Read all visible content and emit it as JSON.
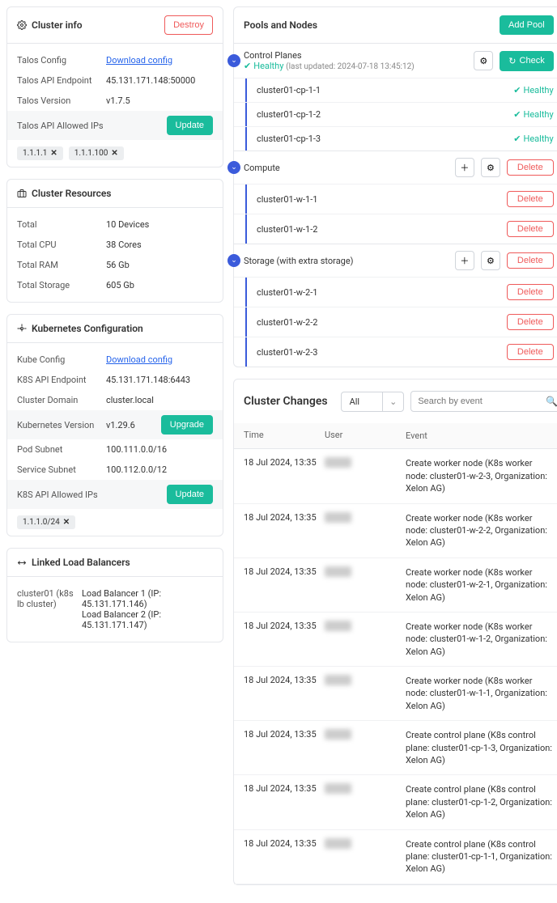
{
  "clusterInfo": {
    "title": "Cluster info",
    "destroy": "Destroy",
    "talosConfigLabel": "Talos Config",
    "talosConfigLink": "Download config",
    "talosApiLabel": "Talos API Endpoint",
    "talosApiValue": "45.131.171.148:50000",
    "talosVersionLabel": "Talos Version",
    "talosVersionValue": "v1.7.5",
    "talosIpsLabel": "Talos API Allowed IPs",
    "updateBtn": "Update",
    "ips": [
      "1.1.1.1",
      "1.1.1.100"
    ]
  },
  "resources": {
    "title": "Cluster Resources",
    "rows": [
      {
        "k": "Total",
        "v": "10 Devices"
      },
      {
        "k": "Total CPU",
        "v": "38 Cores"
      },
      {
        "k": "Total RAM",
        "v": "56 Gb"
      },
      {
        "k": "Total Storage",
        "v": "605 Gb"
      }
    ]
  },
  "kube": {
    "title": "Kubernetes Configuration",
    "configLabel": "Kube Config",
    "configLink": "Download config",
    "apiLabel": "K8S API Endpoint",
    "apiValue": "45.131.171.148:6443",
    "domainLabel": "Cluster Domain",
    "domainValue": "cluster.local",
    "versionLabel": "Kubernetes Version",
    "versionValue": "v1.29.6",
    "upgradeBtn": "Upgrade",
    "podLabel": "Pod Subnet",
    "podValue": "100.111.0.0/16",
    "svcLabel": "Service Subnet",
    "svcValue": "100.112.0.0/12",
    "ipsLabel": "K8S API Allowed IPs",
    "updateBtn": "Update",
    "ip": "1.1.1.0/24"
  },
  "lb": {
    "title": "Linked Load Balancers",
    "name": "cluster01 (k8s lb cluster)",
    "l1": "Load Balancer 1 (IP: 45.131.171.146)",
    "l2": "Load Balancer 2 (IP: 45.131.171.147)"
  },
  "pools": {
    "title": "Pools and Nodes",
    "addBtn": "Add Pool",
    "checkBtn": "Check",
    "deleteBtn": "Delete",
    "healthyLabel": "Healthy",
    "cp": {
      "title": "Control Planes",
      "status": "Healthy",
      "updated": "(last updated: 2024-07-18 13:45:12)",
      "nodes": [
        "cluster01-cp-1-1",
        "cluster01-cp-1-2",
        "cluster01-cp-1-3"
      ]
    },
    "compute": {
      "title": "Compute",
      "nodes": [
        "cluster01-w-1-1",
        "cluster01-w-1-2"
      ]
    },
    "storage": {
      "title": "Storage (with extra storage)",
      "nodes": [
        "cluster01-w-2-1",
        "cluster01-w-2-2",
        "cluster01-w-2-3"
      ]
    }
  },
  "changes": {
    "title": "Cluster Changes",
    "filter": "All",
    "searchPlaceholder": "Search by event",
    "cols": {
      "time": "Time",
      "user": "User",
      "event": "Event"
    },
    "rows": [
      {
        "t": "18 Jul 2024, 13:35",
        "e": "Create worker node (K8s worker node: cluster01-w-2-3, Organization: Xelon AG)"
      },
      {
        "t": "18 Jul 2024, 13:35",
        "e": "Create worker node (K8s worker node: cluster01-w-2-2, Organization: Xelon AG)"
      },
      {
        "t": "18 Jul 2024, 13:35",
        "e": "Create worker node (K8s worker node: cluster01-w-2-1, Organization: Xelon AG)"
      },
      {
        "t": "18 Jul 2024, 13:35",
        "e": "Create worker node (K8s worker node: cluster01-w-1-2, Organization: Xelon AG)"
      },
      {
        "t": "18 Jul 2024, 13:35",
        "e": "Create worker node (K8s worker node: cluster01-w-1-1, Organization: Xelon AG)"
      },
      {
        "t": "18 Jul 2024, 13:35",
        "e": "Create control plane (K8s control plane: cluster01-cp-1-3, Organization: Xelon AG)"
      },
      {
        "t": "18 Jul 2024, 13:35",
        "e": "Create control plane (K8s control plane: cluster01-cp-1-2, Organization: Xelon AG)"
      },
      {
        "t": "18 Jul 2024, 13:35",
        "e": "Create control plane (K8s control plane: cluster01-cp-1-1, Organization: Xelon AG)"
      }
    ]
  }
}
